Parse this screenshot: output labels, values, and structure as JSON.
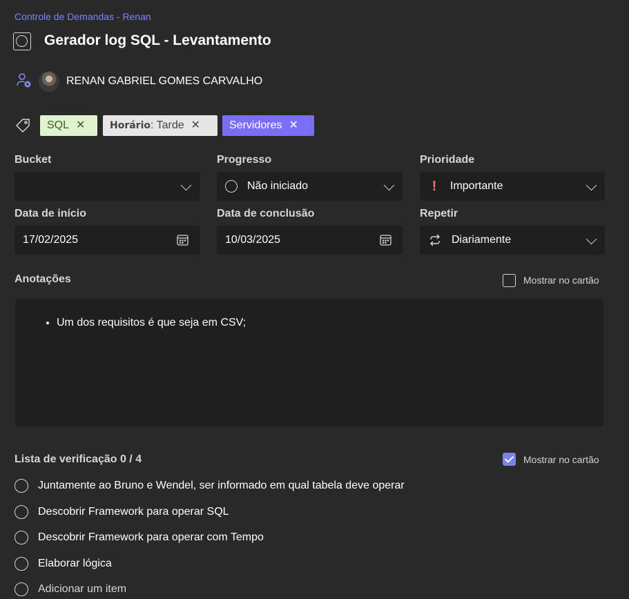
{
  "breadcrumb": "Controle de Demandas - Renan",
  "task": {
    "title": "Gerador log SQL - Levantamento"
  },
  "assignment": {
    "assignee": "RENAN GABRIEL GOMES CARVALHO"
  },
  "labels": [
    {
      "text": "SQL",
      "color": "#dff3cf"
    },
    {
      "bold": "Horário",
      "text": ": Tarde",
      "color": "#e6e6e6"
    },
    {
      "text": "Servidores",
      "color": "#7b6ef6"
    }
  ],
  "fields": {
    "bucket": {
      "label": "Bucket",
      "value": ""
    },
    "progress": {
      "label": "Progresso",
      "value": "Não iniciado"
    },
    "priority": {
      "label": "Prioridade",
      "value": "Importante",
      "icon": "exclamation-icon"
    },
    "start_date": {
      "label": "Data de início",
      "value": "17/02/2025"
    },
    "due_date": {
      "label": "Data de conclusão",
      "value": "10/03/2025"
    },
    "repeat": {
      "label": "Repetir",
      "value": "Diariamente",
      "icon": "repeat-icon"
    }
  },
  "notes": {
    "label": "Anotações",
    "show_on_card_label": "Mostrar no cartão",
    "show_on_card": false,
    "items": [
      "Um dos requisitos é que seja em CSV;"
    ]
  },
  "checklist": {
    "label": "Lista de verificação 0 / 4",
    "show_on_card_label": "Mostrar no cartão",
    "show_on_card": true,
    "items": [
      "Juntamente ao Bruno e Wendel, ser informado em qual tabela deve operar",
      "Descobrir Framework para operar SQL",
      "Descobrir Framework para operar com Tempo",
      "Elaborar lógica"
    ],
    "add_item_placeholder": "Adicionar um item"
  },
  "colors": {
    "background": "#292929",
    "field": "#1f1f1f",
    "accent": "#7f85f5",
    "priority": "#f1707b"
  }
}
